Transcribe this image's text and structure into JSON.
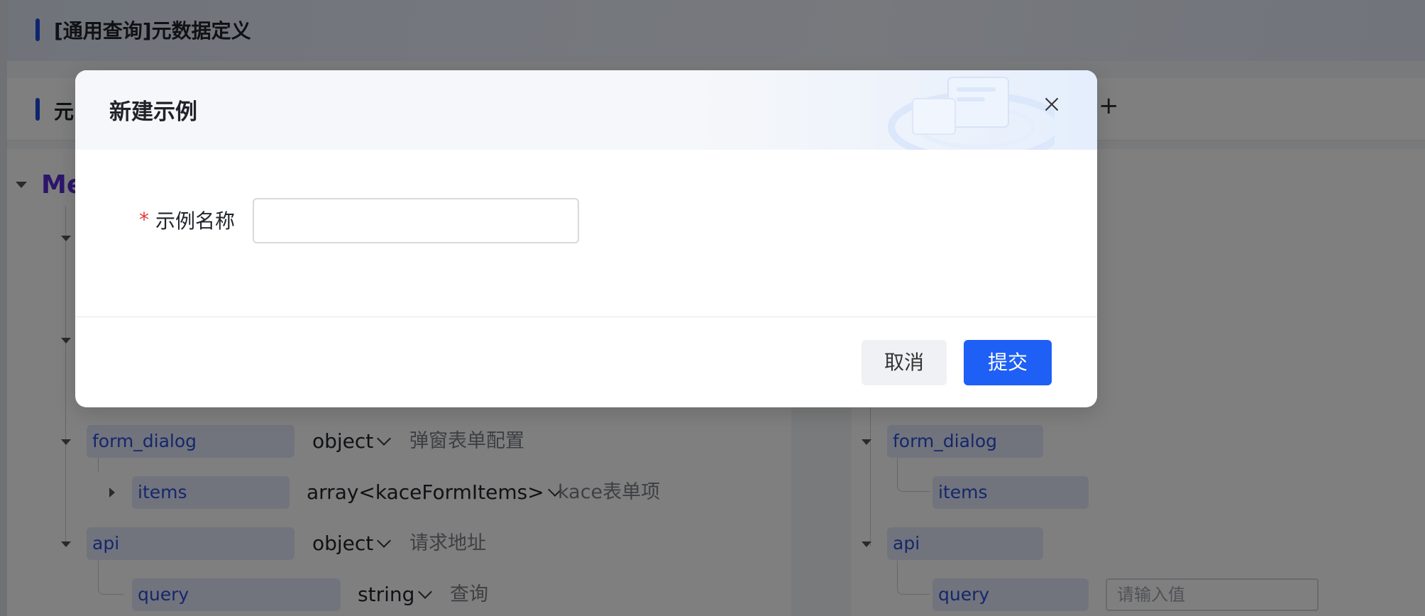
{
  "page": {
    "title": "[通用查询]元数据定义",
    "section_title": "元",
    "root_label": "Me",
    "add_icon": "plus-icon"
  },
  "tree_left": {
    "form_dialog": {
      "key": "form_dialog",
      "type": "object",
      "desc": "弹窗表单配置"
    },
    "items": {
      "key": "items",
      "type": "array<kaceFormItems>",
      "desc": "kace表单项"
    },
    "api": {
      "key": "api",
      "type": "object",
      "desc": "请求地址"
    },
    "query": {
      "key": "query",
      "type": "string",
      "desc": "查询"
    }
  },
  "tree_right": {
    "form_dialog": "form_dialog",
    "items": "items",
    "api": "api",
    "query": "query",
    "value_placeholder": "请输入值"
  },
  "dialog": {
    "title": "新建示例",
    "close_icon": "close-icon",
    "field_required_mark": "*",
    "field_label": "示例名称",
    "field_value": "",
    "field_placeholder": "",
    "cancel_label": "取消",
    "submit_label": "提交"
  },
  "colors": {
    "primary": "#1e5ff5",
    "accent_bar": "#1d4bdc",
    "key_pill_bg": "#e3e8fb",
    "key_text": "#2a4fd8",
    "root_label": "#5a2bd6",
    "required": "#e23b3b"
  }
}
